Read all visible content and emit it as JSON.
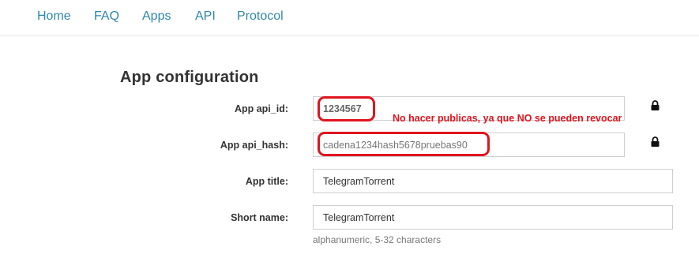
{
  "nav": {
    "items": [
      "Home",
      "FAQ",
      "Apps",
      "API",
      "Protocol"
    ],
    "color": "#2e87a8"
  },
  "page": {
    "title": "App configuration"
  },
  "form": {
    "api_id_label": "App api_id:",
    "api_id_value": "1234567",
    "api_hash_label": "App api_hash:",
    "api_hash_value": "cadena1234hash5678pruebas90",
    "app_title_label": "App title:",
    "app_title_value": "TelegramTorrent",
    "short_name_label": "Short name:",
    "short_name_value": "TelegramTorrent",
    "short_name_hint": "alphanumeric, 5-32 characters"
  },
  "annotation": {
    "text": "No hacer publicas, ya que NO se pueden revocar",
    "color": "#e0141e"
  },
  "icons": {
    "lock": "lock-icon"
  }
}
